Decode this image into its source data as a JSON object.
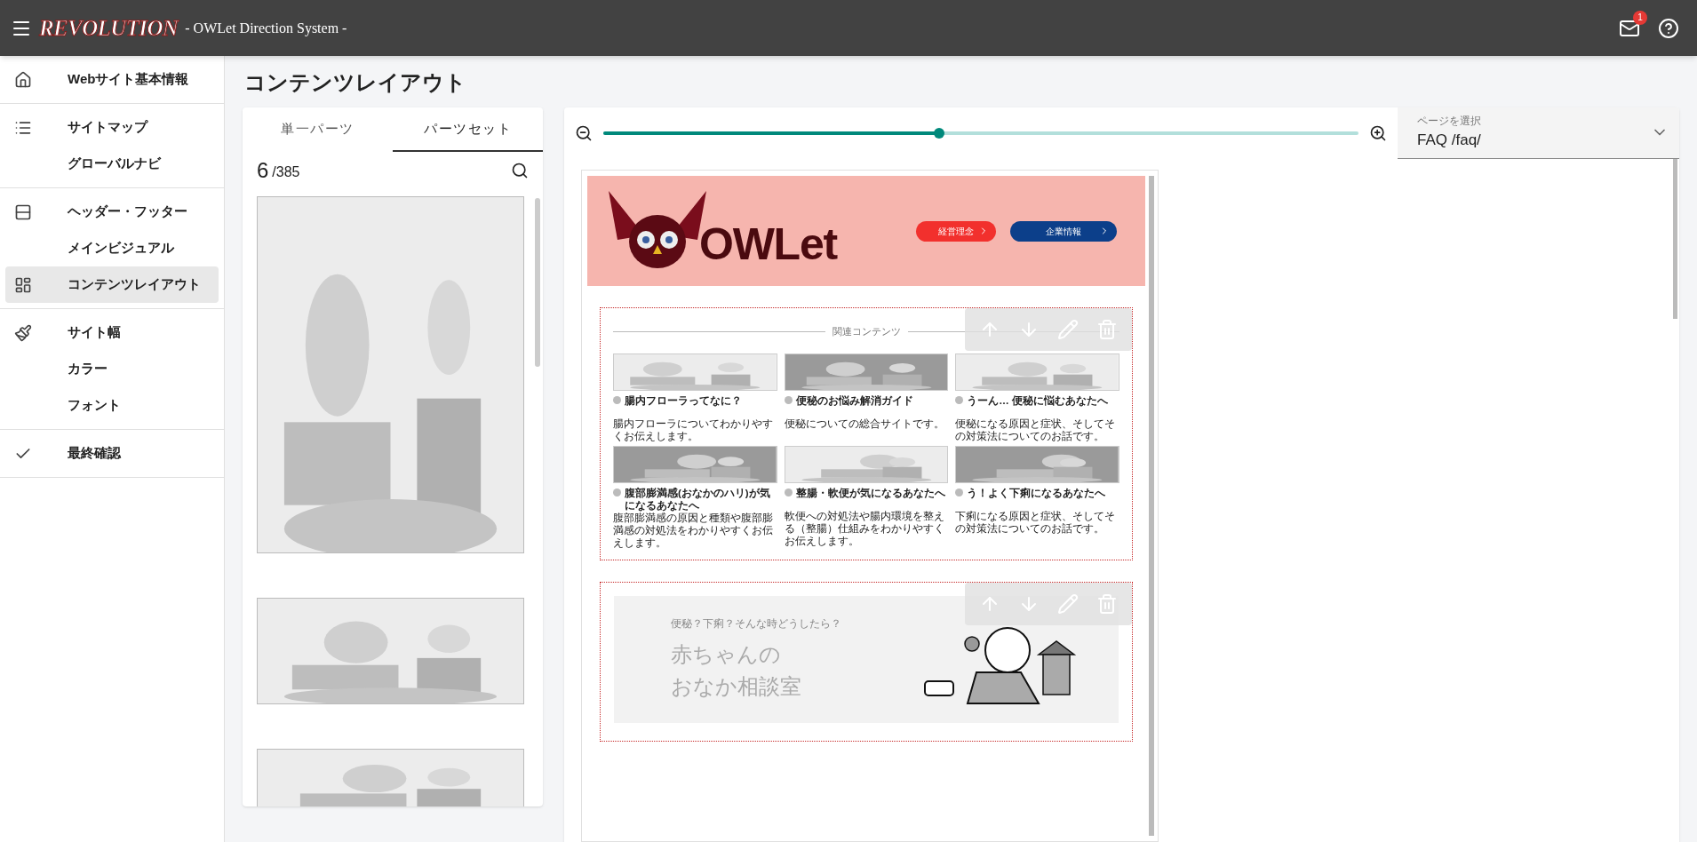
{
  "header": {
    "logo": "REVOLUTION",
    "subtitle": "- OWLet Direction System -",
    "notification_count": "1"
  },
  "sidebar": {
    "groups": [
      [
        {
          "label": "Webサイト基本情報",
          "selected": false
        }
      ],
      [
        {
          "label": "サイトマップ",
          "selected": false
        },
        {
          "label": "グローバルナビ",
          "selected": false
        }
      ],
      [
        {
          "label": "ヘッダー・フッター",
          "selected": false
        },
        {
          "label": "メインビジュアル",
          "selected": false
        },
        {
          "label": "コンテンツレイアウト",
          "selected": true
        }
      ],
      [
        {
          "label": "サイト幅",
          "selected": false
        },
        {
          "label": "カラー",
          "selected": false
        },
        {
          "label": "フォント",
          "selected": false
        }
      ],
      [
        {
          "label": "最終確認",
          "selected": false
        }
      ]
    ]
  },
  "page_title": "コンテンツレイアウト",
  "parts_panel": {
    "tabs": [
      {
        "label": "単一パーツ",
        "selected": false
      },
      {
        "label": "パーツセット",
        "selected": true
      }
    ],
    "count": "6",
    "total": "/385"
  },
  "preview_panel": {
    "zoom": {
      "level": 0.445
    },
    "page_select": {
      "label": "ページを選択",
      "value": "FAQ /faq/"
    },
    "site_header": {
      "logo": "OWLet",
      "buttons": [
        {
          "label": "経営理念",
          "color": "#f2302d"
        },
        {
          "label": "企業情報",
          "color": "#0c3f8a"
        }
      ]
    },
    "related_section": {
      "heading": "関連コンテンツ",
      "cards": [
        {
          "title": "腸内フローラってなに？",
          "text": "腸内フローラについてわかりやすくお伝えします。"
        },
        {
          "title": "便秘のお悩み解消ガイド",
          "text": "便秘についての総合サイトです。"
        },
        {
          "title": "うーん… 便秘に悩むあなたへ",
          "text": "便秘になる原因と症状、そしてその対策法についてのお話です。"
        },
        {
          "title": "腹部膨満感(おなかのハリ)が気になるあなたへ",
          "text": "腹部膨満感の原因と種類や腹部膨満感の対処法をわかりやすくお伝えします。"
        },
        {
          "title": "整腸・軟便が気になるあなたへ",
          "text": "軟便への対処法や腸内環境を整える（整腸）仕組みをわかりやすくお伝えします。"
        },
        {
          "title": "う！よく下痢になるあなたへ",
          "text": "下痢になる原因と症状、そしてその対策法についてのお話です。"
        }
      ]
    },
    "hero_section": {
      "subtitle": "便秘？下痢？そんな時どうしたら？",
      "title_lines": [
        "赤ちゃんの",
        "おなか相談室"
      ]
    }
  }
}
